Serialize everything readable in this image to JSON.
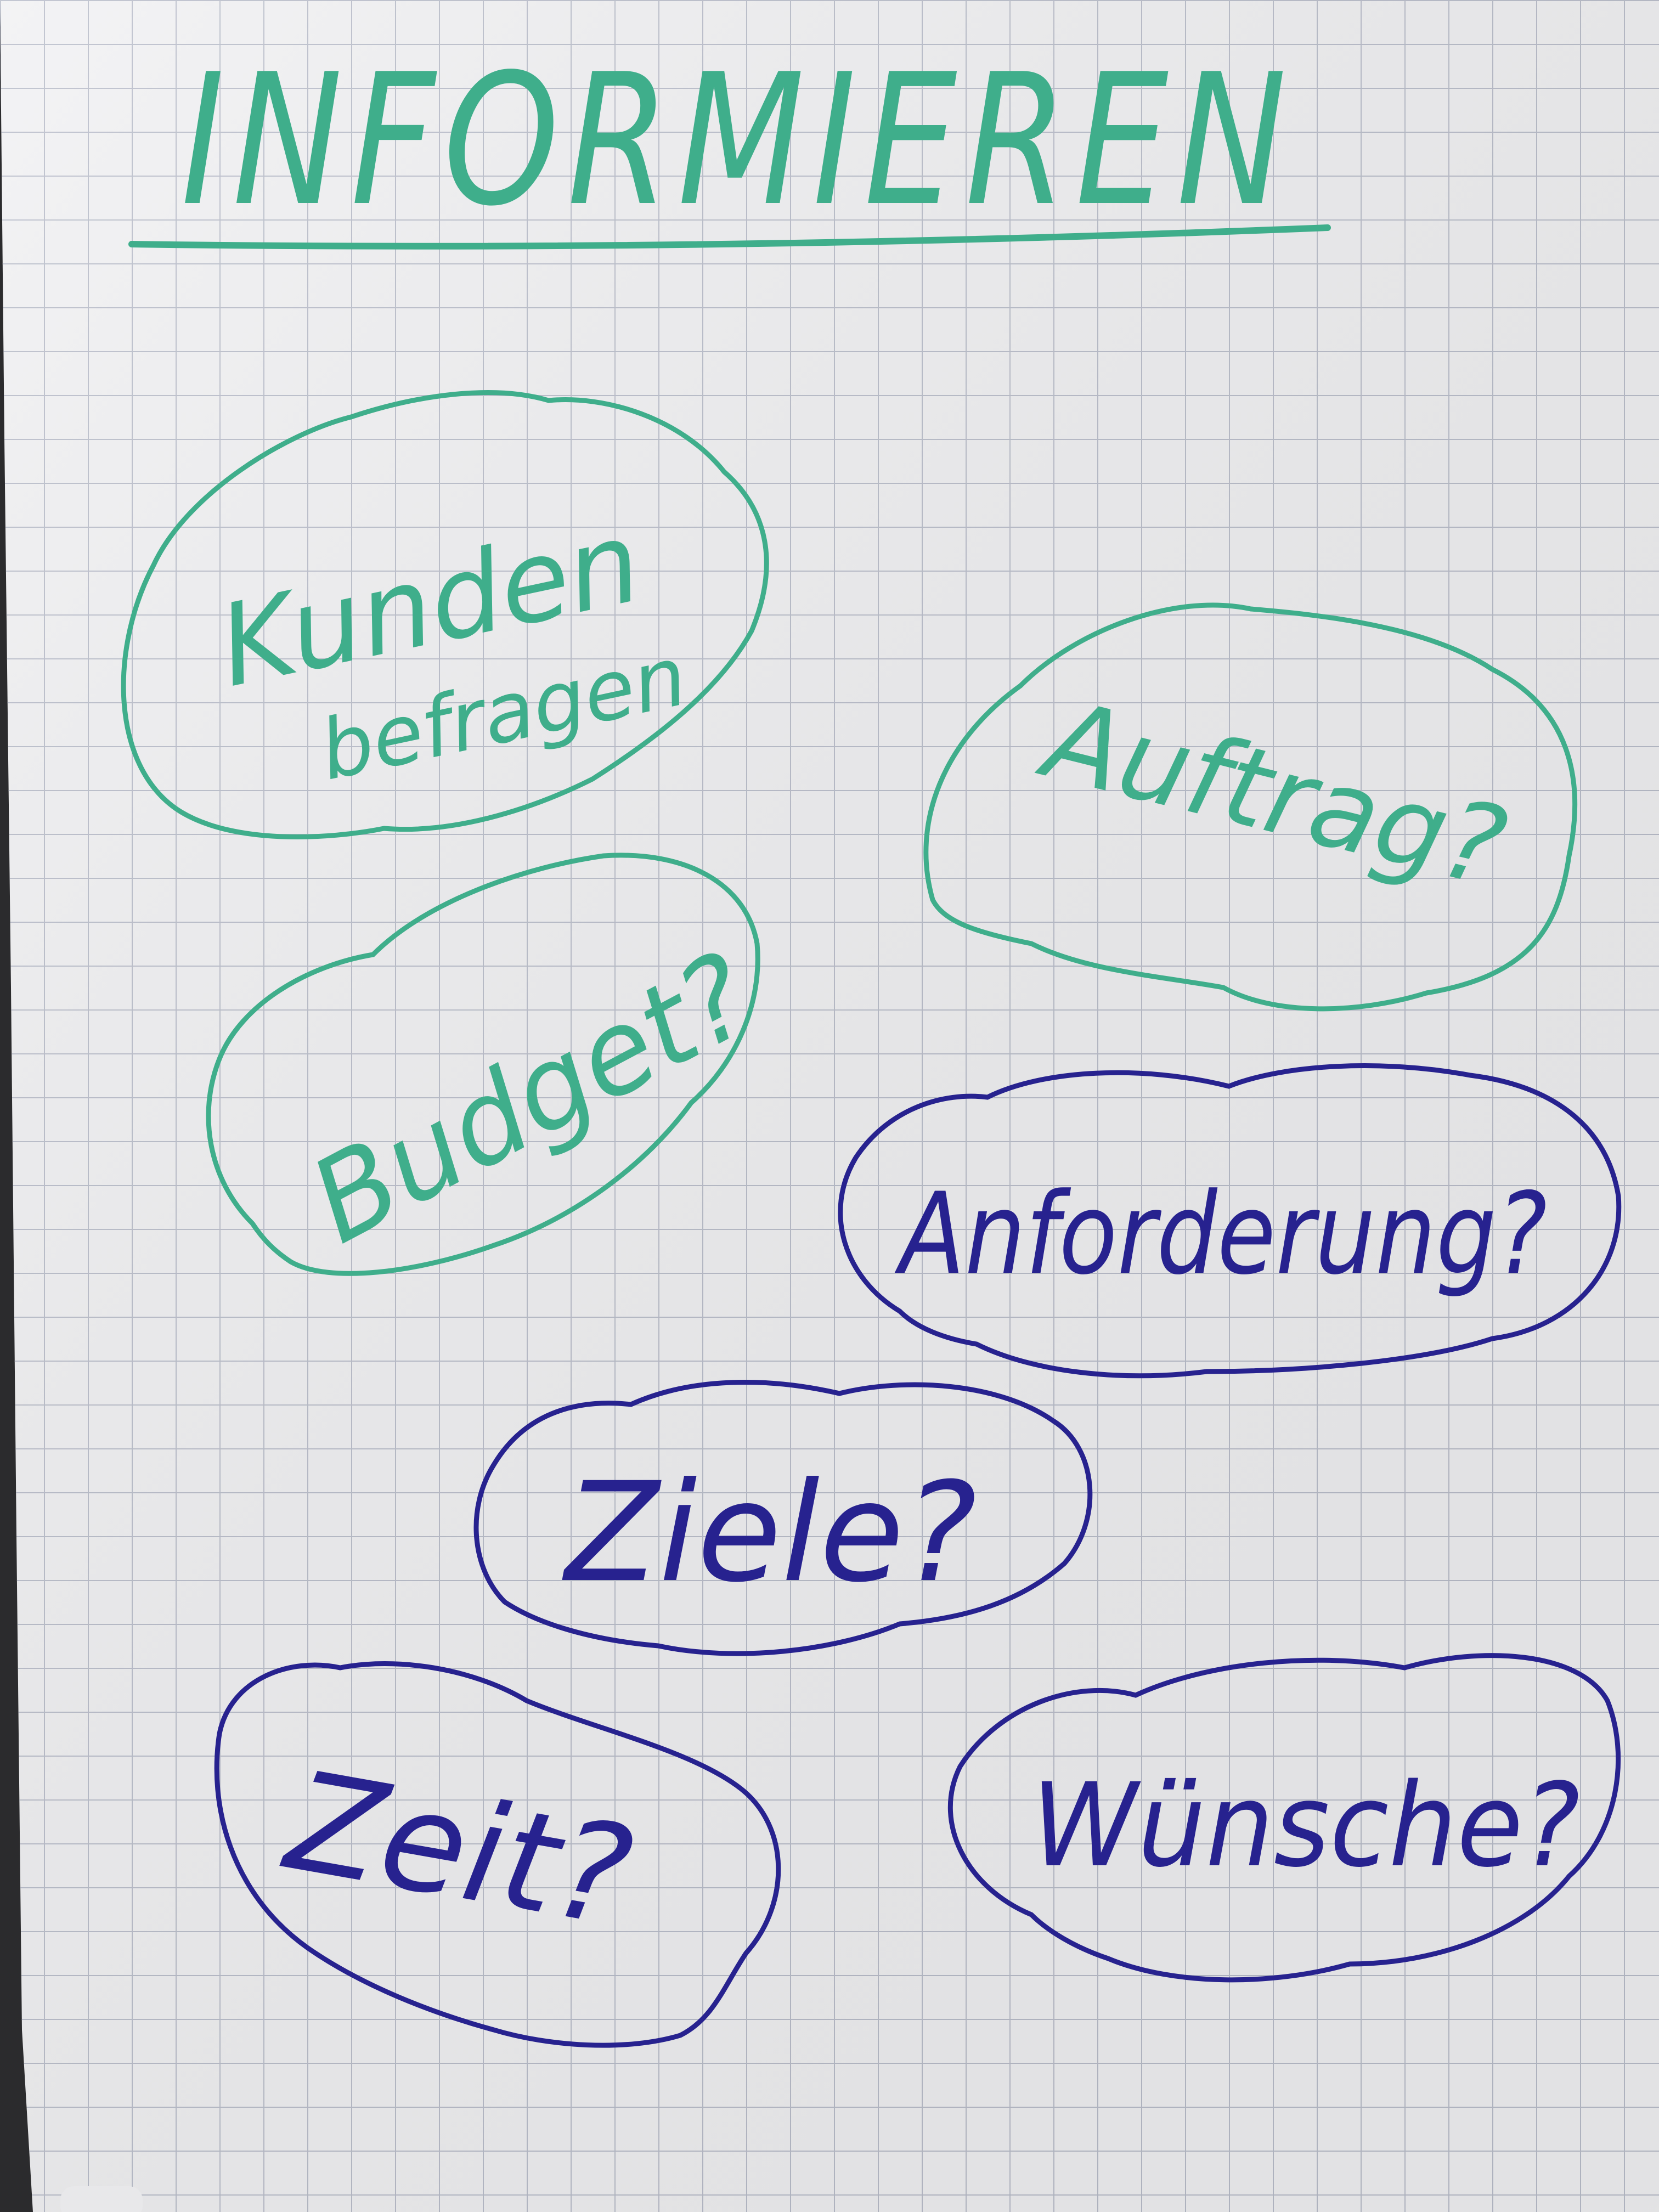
{
  "title": "INFORMIEREN",
  "colors": {
    "green": "#3fae8b",
    "blue": "#27228f",
    "paper": "#f1f1f3",
    "grid": "#b9bdca"
  },
  "bubbles": [
    {
      "lines": [
        "Kunden",
        "befragen"
      ],
      "color": "green"
    },
    {
      "lines": [
        "Auftrag?"
      ],
      "color": "green"
    },
    {
      "lines": [
        "Budget?"
      ],
      "color": "green"
    },
    {
      "lines": [
        "Anforderung?"
      ],
      "color": "blue"
    },
    {
      "lines": [
        "Ziele?"
      ],
      "color": "blue"
    },
    {
      "lines": [
        "Zeit?"
      ],
      "color": "blue"
    },
    {
      "lines": [
        "Wünsche?"
      ],
      "color": "blue"
    }
  ]
}
